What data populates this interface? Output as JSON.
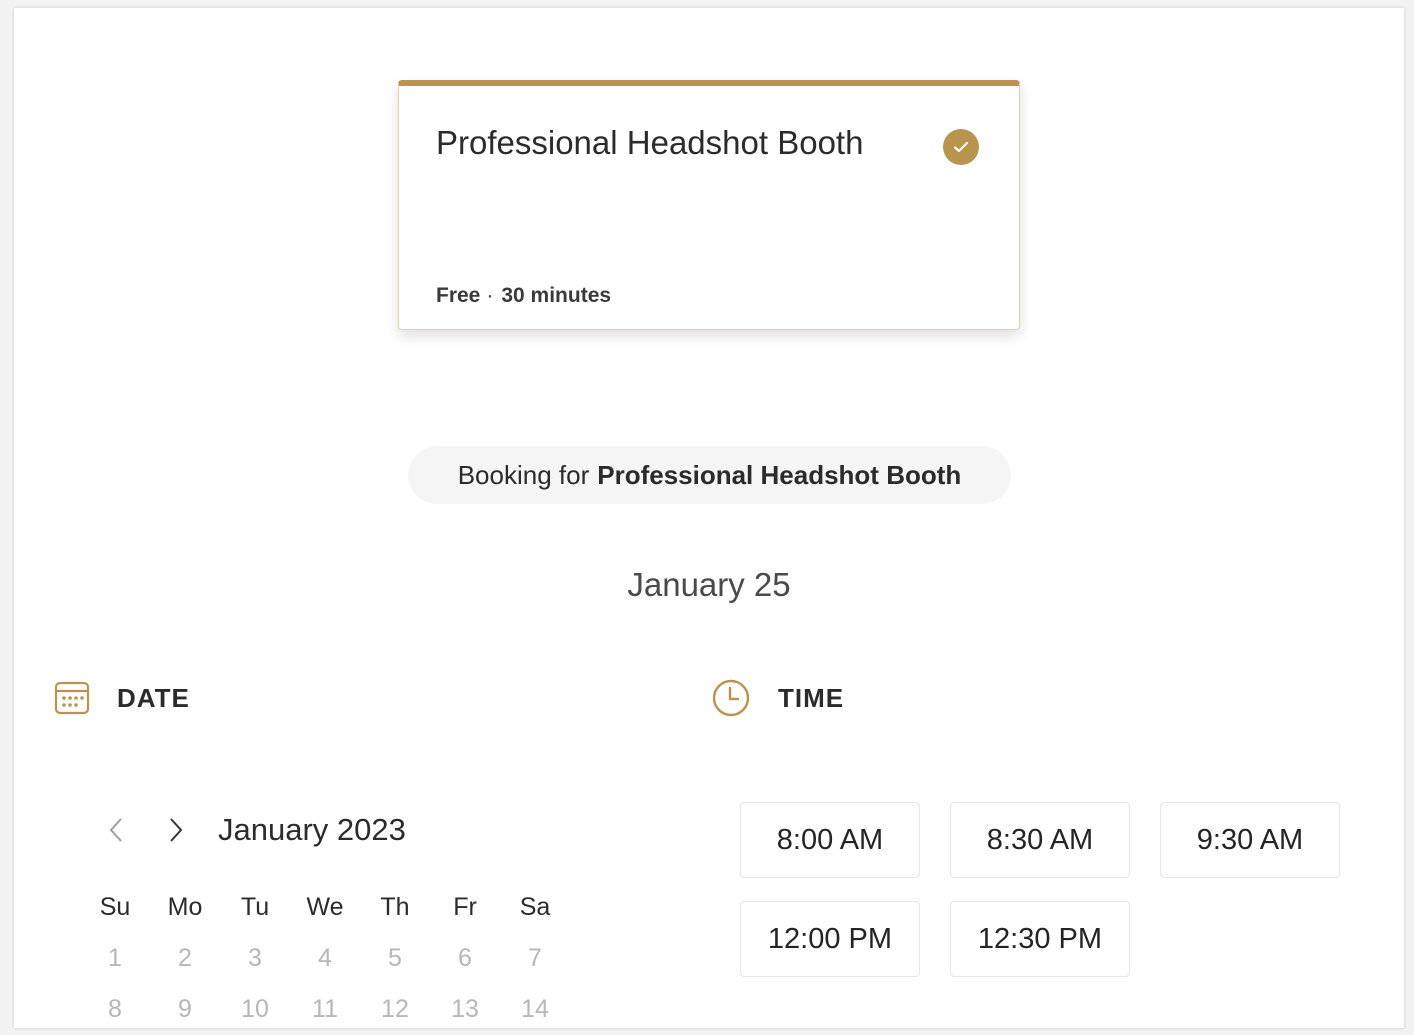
{
  "service": {
    "title": "Professional Headshot Booth",
    "price": "Free",
    "separator": "·",
    "duration": "30 minutes",
    "selected": true
  },
  "booking_banner": {
    "prefix": "Booking for",
    "service_name": "Professional Headshot Booth"
  },
  "selected_date_label": "January 25",
  "date_section": {
    "label": "DATE",
    "icon": "calendar-icon",
    "month_label": "January 2023",
    "weekdays": [
      "Su",
      "Mo",
      "Tu",
      "We",
      "Th",
      "Fr",
      "Sa"
    ],
    "weeks": [
      [
        "1",
        "2",
        "3",
        "4",
        "5",
        "6",
        "7"
      ],
      [
        "8",
        "9",
        "10",
        "11",
        "12",
        "13",
        "14"
      ]
    ]
  },
  "time_section": {
    "label": "TIME",
    "icon": "clock-icon",
    "slots": [
      "8:00 AM",
      "8:30 AM",
      "9:30 AM",
      "12:00 PM",
      "12:30 PM"
    ]
  },
  "colors": {
    "accent": "#b8944f",
    "disabled_day": "#b7b7b7"
  }
}
